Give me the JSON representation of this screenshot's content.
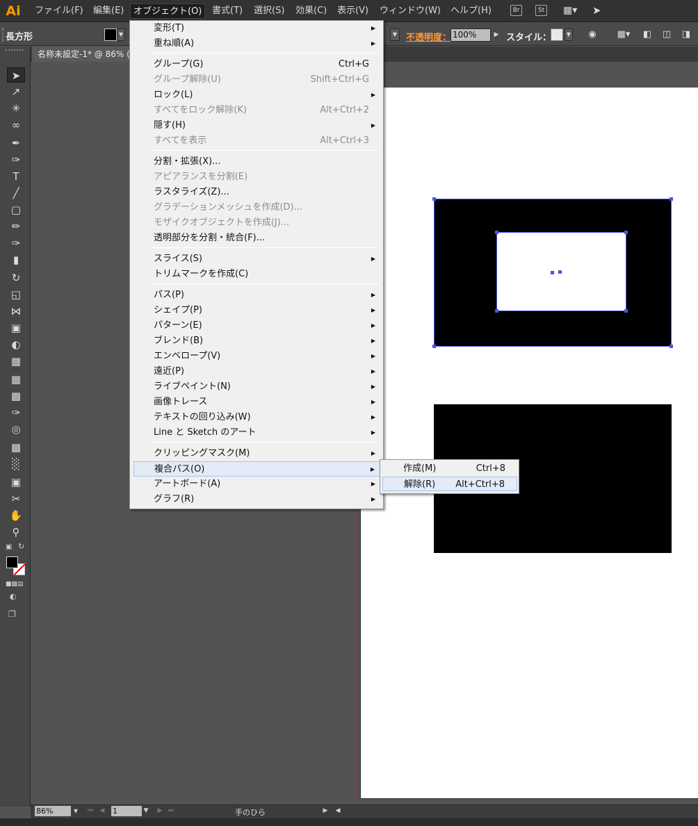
{
  "app": {
    "logo": "Ai"
  },
  "menubar": {
    "items": [
      "ファイル(F)",
      "編集(E)",
      "オブジェクト(O)",
      "書式(T)",
      "選択(S)",
      "効果(C)",
      "表示(V)",
      "ウィンドウ(W)",
      "ヘルプ(H)"
    ],
    "active_index": 2,
    "icons": {
      "bridge": "Br",
      "stock": "St",
      "arrange": "arrange-documents-icon",
      "sync": "sync-icon"
    }
  },
  "controlbar": {
    "object_type": "長方形",
    "fill_color": "#000000",
    "opacity_label": "不透明度：",
    "opacity_value": "100%",
    "style_label": "スタイル："
  },
  "document": {
    "tab_title": "名称未設定-1* @ 86% (C"
  },
  "object_menu": {
    "items": [
      {
        "label": "変形(T)",
        "shortcut": "",
        "submenu": true,
        "disabled": false
      },
      {
        "label": "重ね順(A)",
        "shortcut": "",
        "submenu": true,
        "disabled": false
      },
      {
        "label": "グループ(G)",
        "shortcut": "Ctrl+G",
        "submenu": false,
        "disabled": false
      },
      {
        "label": "グループ解除(U)",
        "shortcut": "Shift+Ctrl+G",
        "submenu": false,
        "disabled": true
      },
      {
        "label": "ロック(L)",
        "shortcut": "",
        "submenu": true,
        "disabled": false
      },
      {
        "label": "すべてをロック解除(K)",
        "shortcut": "Alt+Ctrl+2",
        "submenu": false,
        "disabled": true
      },
      {
        "label": "隠す(H)",
        "shortcut": "",
        "submenu": true,
        "disabled": false
      },
      {
        "label": "すべてを表示",
        "shortcut": "Alt+Ctrl+3",
        "submenu": false,
        "disabled": true
      },
      {
        "label": "分割・拡張(X)...",
        "shortcut": "",
        "submenu": false,
        "disabled": false
      },
      {
        "label": "アピアランスを分割(E)",
        "shortcut": "",
        "submenu": false,
        "disabled": true
      },
      {
        "label": "ラスタライズ(Z)...",
        "shortcut": "",
        "submenu": false,
        "disabled": false
      },
      {
        "label": "グラデーションメッシュを作成(D)...",
        "shortcut": "",
        "submenu": false,
        "disabled": true
      },
      {
        "label": "モザイクオブジェクトを作成(J)...",
        "shortcut": "",
        "submenu": false,
        "disabled": true
      },
      {
        "label": "透明部分を分割・統合(F)...",
        "shortcut": "",
        "submenu": false,
        "disabled": false
      },
      {
        "label": "スライス(S)",
        "shortcut": "",
        "submenu": true,
        "disabled": false
      },
      {
        "label": "トリムマークを作成(C)",
        "shortcut": "",
        "submenu": false,
        "disabled": false
      },
      {
        "label": "パス(P)",
        "shortcut": "",
        "submenu": true,
        "disabled": false
      },
      {
        "label": "シェイプ(P)",
        "shortcut": "",
        "submenu": true,
        "disabled": false
      },
      {
        "label": "パターン(E)",
        "shortcut": "",
        "submenu": true,
        "disabled": false
      },
      {
        "label": "ブレンド(B)",
        "shortcut": "",
        "submenu": true,
        "disabled": false
      },
      {
        "label": "エンベロープ(V)",
        "shortcut": "",
        "submenu": true,
        "disabled": false
      },
      {
        "label": "遠近(P)",
        "shortcut": "",
        "submenu": true,
        "disabled": false
      },
      {
        "label": "ライブペイント(N)",
        "shortcut": "",
        "submenu": true,
        "disabled": false
      },
      {
        "label": "画像トレース",
        "shortcut": "",
        "submenu": true,
        "disabled": false
      },
      {
        "label": "テキストの回り込み(W)",
        "shortcut": "",
        "submenu": true,
        "disabled": false
      },
      {
        "label": "Line と Sketch のアート",
        "shortcut": "",
        "submenu": true,
        "disabled": false
      },
      {
        "label": "クリッピングマスク(M)",
        "shortcut": "",
        "submenu": true,
        "disabled": false
      },
      {
        "label": "複合パス(O)",
        "shortcut": "",
        "submenu": true,
        "disabled": false
      },
      {
        "label": "アートボード(A)",
        "shortcut": "",
        "submenu": true,
        "disabled": false
      },
      {
        "label": "グラフ(R)",
        "shortcut": "",
        "submenu": true,
        "disabled": false
      }
    ],
    "highlighted_index": 27
  },
  "compound_path_submenu": {
    "items": [
      {
        "label": "作成(M)",
        "shortcut": "Ctrl+8"
      },
      {
        "label": "解除(R)",
        "shortcut": "Alt+Ctrl+8"
      }
    ],
    "highlighted_index": 1
  },
  "statusbar": {
    "zoom": "86%",
    "page": "1",
    "status_text": "手のひら"
  },
  "tools": [
    "selection-tool-icon",
    "direct-selection-tool-icon",
    "magic-wand-tool-icon",
    "lasso-tool-icon",
    "pen-tool-icon",
    "curvature-tool-icon",
    "type-tool-icon",
    "line-segment-tool-icon",
    "rectangle-tool-icon",
    "paintbrush-tool-icon",
    "blob-brush-tool-icon",
    "eraser-tool-icon",
    "rotate-tool-icon",
    "scale-tool-icon",
    "width-tool-icon",
    "free-transform-tool-icon",
    "shape-builder-tool-icon",
    "perspective-grid-tool-icon",
    "mesh-tool-icon",
    "gradient-tool-icon",
    "eyedropper-tool-icon",
    "blend-tool-icon",
    "symbol-sprayer-tool-icon",
    "column-graph-tool-icon",
    "artboard-tool-icon",
    "slice-tool-icon",
    "hand-tool-icon",
    "zoom-tool-icon"
  ],
  "colors": {
    "selection": "#4a55e0",
    "menu_highlight": "#e2ebf7",
    "bleed_guide": "#a82d37",
    "accent": "#ff9a00"
  }
}
